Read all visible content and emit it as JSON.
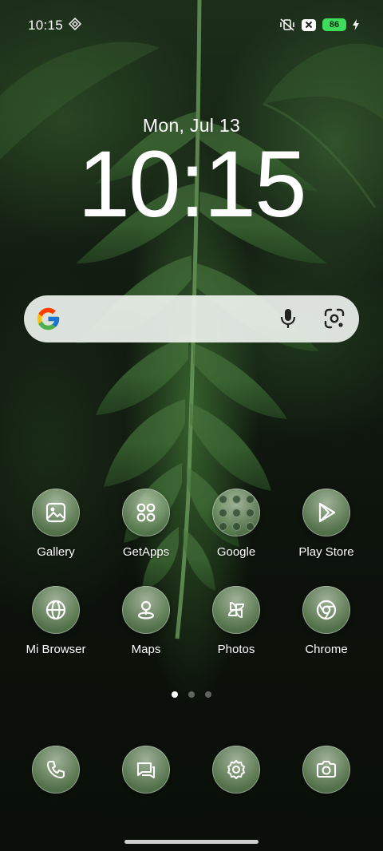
{
  "status_bar": {
    "time": "10:15",
    "battery_level": "86",
    "icons": [
      "network-icon",
      "vibrate-mute-icon",
      "x-badge-icon",
      "battery-icon",
      "charging-bolt-icon"
    ],
    "battery_color": "#3ddc5a"
  },
  "lockscreen": {
    "date": "Mon, Jul 13",
    "clock": "10:15"
  },
  "search_bar": {
    "icons": [
      "google-g-icon",
      "mic-icon",
      "lens-icon"
    ]
  },
  "apps_row1": [
    {
      "label": "Gallery",
      "icon": "gallery-icon"
    },
    {
      "label": "GetApps",
      "icon": "getapps-icon"
    },
    {
      "label": "Google",
      "icon": "google-folder-icon"
    },
    {
      "label": "Play Store",
      "icon": "play-store-icon"
    }
  ],
  "apps_row2": [
    {
      "label": "Mi Browser",
      "icon": "globe-icon"
    },
    {
      "label": "Maps",
      "icon": "map-pin-icon"
    },
    {
      "label": "Photos",
      "icon": "pinwheel-icon"
    },
    {
      "label": "Chrome",
      "icon": "chrome-icon"
    }
  ],
  "dock": [
    {
      "icon": "phone-icon"
    },
    {
      "icon": "messages-icon"
    },
    {
      "icon": "settings-icon"
    },
    {
      "icon": "camera-icon"
    }
  ],
  "page_indicator": {
    "pages": 3,
    "active": 1
  },
  "colors": {
    "icon_tint": "#9bb58f",
    "search_bg": "#ebf0eb",
    "wallpaper_green": "#2f5a2a"
  }
}
